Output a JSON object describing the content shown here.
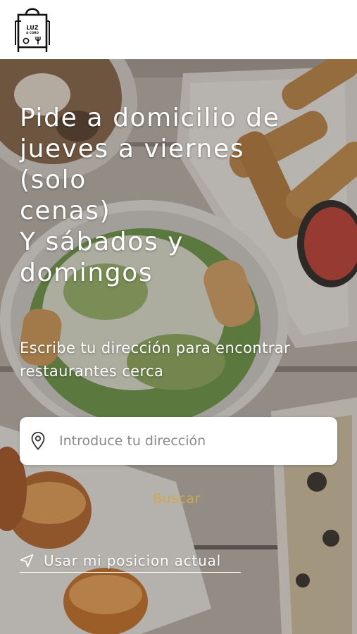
{
  "brand": {
    "logo_line1": "LUZ",
    "logo_line2": "& CORO"
  },
  "hero": {
    "headline": "Pide a domicilio de\njueves a viernes\n(solo\ncenas)\nY sábados y\ndomingos",
    "subtitle": "Escribe tu dirección para encontrar restaurantes cerca"
  },
  "search": {
    "placeholder": "Introduce tu dirección",
    "value": "",
    "button_label": "Buscar"
  },
  "location": {
    "label": "Usar mi posicion actual"
  },
  "icons": {
    "logo": "shopping-bag-logo-icon",
    "address": "map-pin-icon",
    "location": "navigation-arrow-icon"
  },
  "colors": {
    "accent": "#cfa94a",
    "text_on_image": "#ffffff",
    "input_background": "#ffffff",
    "placeholder": "#8a8a8a"
  }
}
